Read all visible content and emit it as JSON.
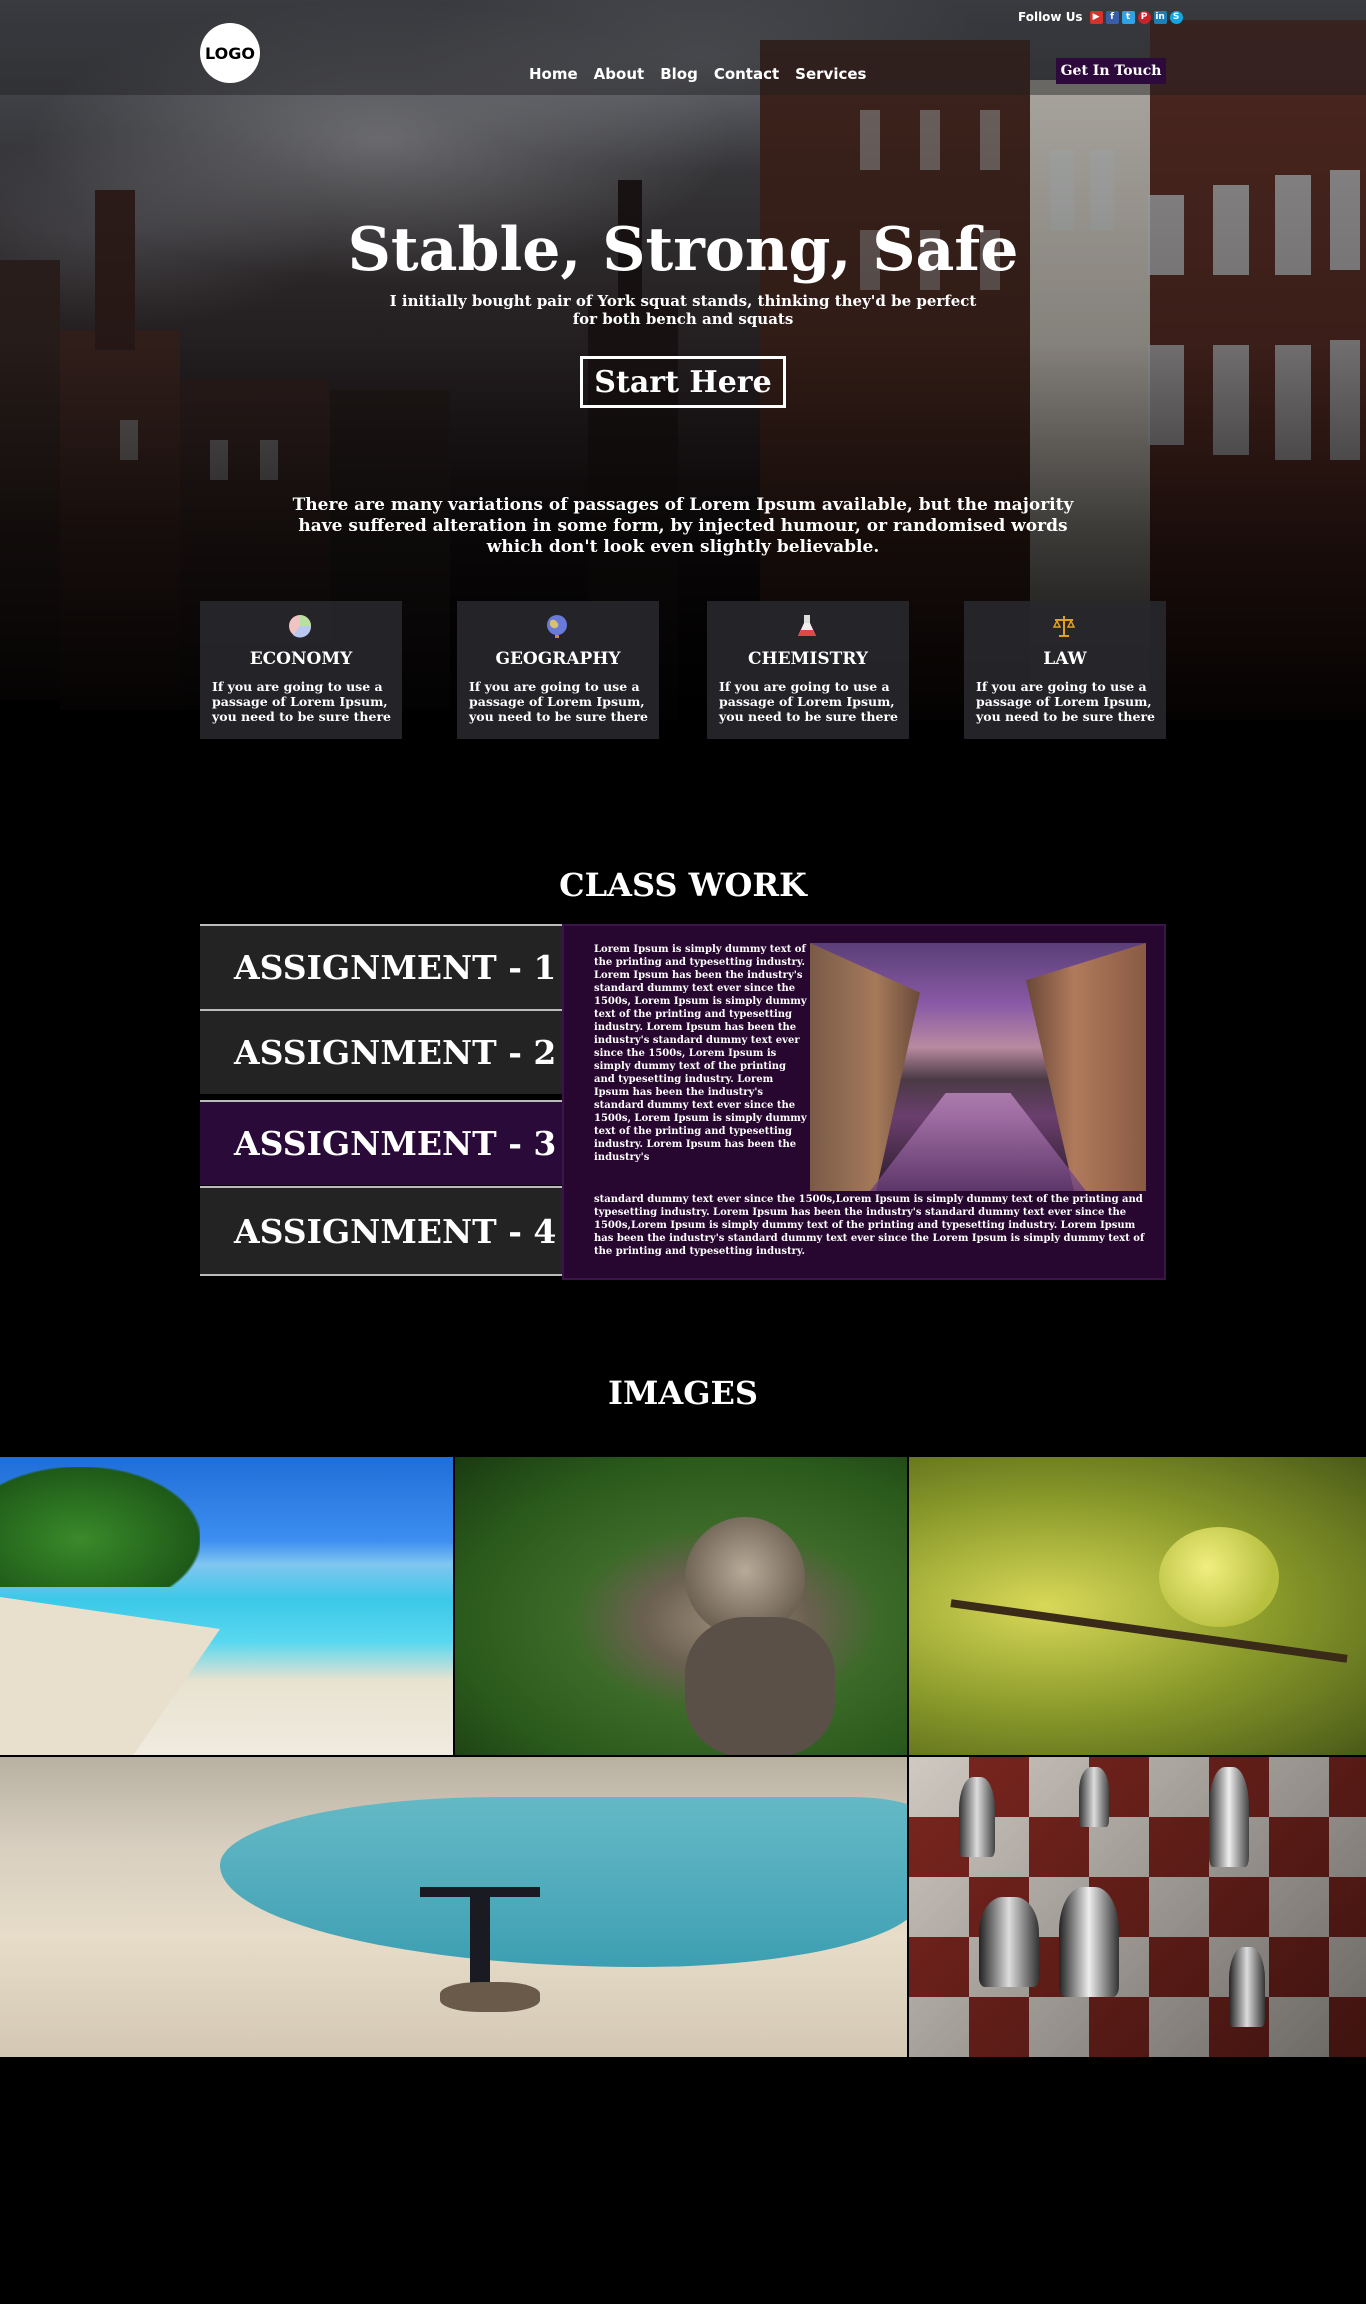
{
  "header": {
    "logo": "LOGO",
    "follow_label": "Follow Us",
    "social_icons": [
      "youtube-icon",
      "facebook-icon",
      "twitter-icon",
      "pinterest-icon",
      "linkedin-icon",
      "skype-icon"
    ],
    "nav": [
      "Home",
      "About",
      "Blog",
      "Contact",
      "Services"
    ],
    "cta": "Get In Touch"
  },
  "hero": {
    "title": "Stable, Strong, Safe",
    "subtitle": "I initially bought pair of York squat stands, thinking they'd be perfect for both bench and squats",
    "button": "Start Here",
    "paragraph": "There are many variations of passages of Lorem Ipsum available, but the majority have suffered alteration in some form, by injected humour, or randomised words which don't look even slightly believable."
  },
  "cards": [
    {
      "icon": "pie-chart-icon",
      "title": "ECONOMY",
      "text": "If you are going to use a passage of Lorem Ipsum, you need to be sure there"
    },
    {
      "icon": "globe-icon",
      "title": "GEOGRAPHY",
      "text": "If you are going to use a passage of Lorem Ipsum, you need to be sure there"
    },
    {
      "icon": "flask-icon",
      "title": "CHEMISTRY",
      "text": "If you are going to use a passage of Lorem Ipsum, you need to be sure there"
    },
    {
      "icon": "scales-icon",
      "title": "LAW",
      "text": "If you are going to use a passage of Lorem Ipsum, you need to be sure there"
    }
  ],
  "classwork": {
    "title": "CLASS WORK",
    "tabs": [
      "ASSIGNMENT - 1",
      "ASSIGNMENT - 2",
      "ASSIGNMENT - 3",
      "ASSIGNMENT - 4"
    ],
    "active_tab": "ASSIGNMENT - 3",
    "text_side": "Lorem Ipsum is simply dummy text of the printing and typesetting industry. Lorem Ipsum has been the industry's standard dummy text ever since the 1500s, Lorem Ipsum is simply dummy text of the printing and typesetting industry. Lorem Ipsum has been the industry's standard dummy text ever since the 1500s, Lorem Ipsum is simply dummy text of the printing and typesetting industry. Lorem Ipsum has been the industry's standard dummy text ever since the 1500s, Lorem Ipsum is simply dummy text of the printing and typesetting industry. Lorem Ipsum has been the industry's",
    "text_bottom": "standard dummy text ever since the 1500s,Lorem Ipsum is simply dummy text of  the printing and typesetting industry. Lorem Ipsum has been the industry's standard dummy text ever since the 1500s,Lorem Ipsum is simply dummy text of the printing and typesetting industry. Lorem Ipsum has been the industry's standard dummy text ever since the Lorem Ipsum is simply dummy text of the printing and typesetting industry."
  },
  "images": {
    "title": "IMAGES"
  },
  "colors": {
    "accent_purple": "#2e0a3c",
    "panel_purple": "#27072f",
    "card_bg": "#28282c",
    "tab_bg": "#232323"
  }
}
